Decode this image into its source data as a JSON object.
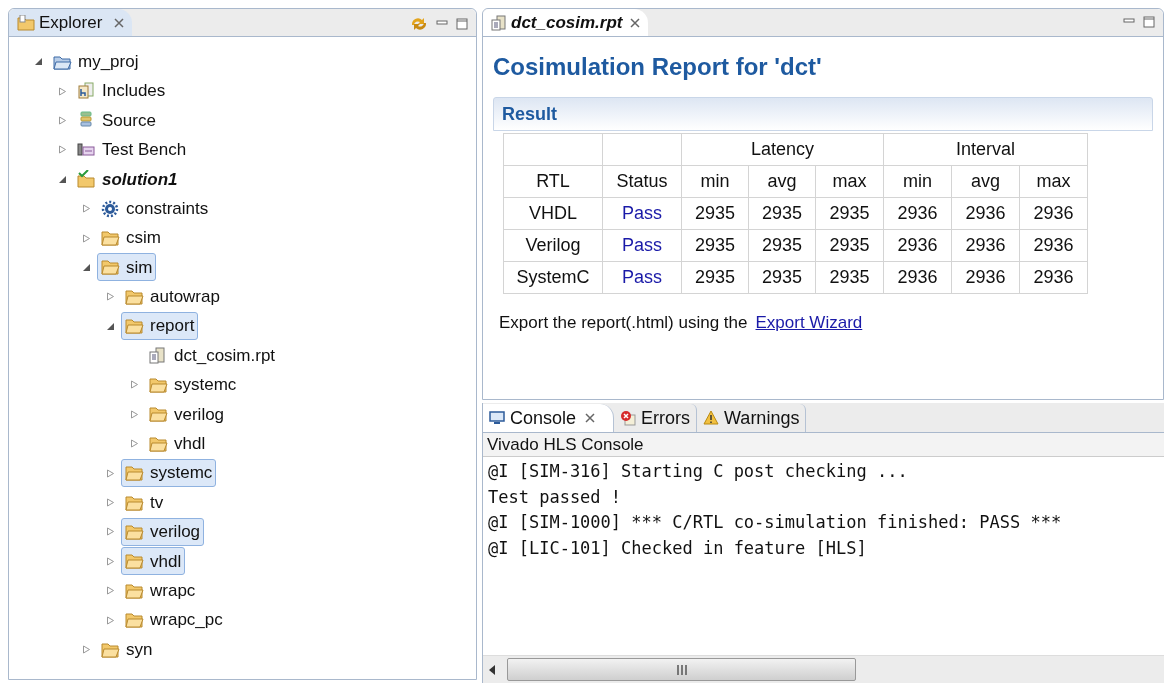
{
  "explorer": {
    "title": "Explorer",
    "tree": [
      {
        "label": "my_proj",
        "kind": "project",
        "expanded": true,
        "selected": false,
        "emphasized": false,
        "children": [
          {
            "label": "Includes",
            "kind": "includes",
            "expanded": false,
            "selected": false,
            "emphasized": false
          },
          {
            "label": "Source",
            "kind": "source",
            "expanded": false,
            "selected": false,
            "emphasized": false
          },
          {
            "label": "Test Bench",
            "kind": "testbench",
            "expanded": false,
            "selected": false,
            "emphasized": false
          },
          {
            "label": "solution1",
            "kind": "solution",
            "expanded": true,
            "selected": false,
            "emphasized": true,
            "children": [
              {
                "label": "constraints",
                "kind": "constraints",
                "expanded": false,
                "selected": false,
                "emphasized": false
              },
              {
                "label": "csim",
                "kind": "folder",
                "expanded": false,
                "selected": false,
                "emphasized": false
              },
              {
                "label": "sim",
                "kind": "folder",
                "expanded": true,
                "selected": true,
                "emphasized": false,
                "children": [
                  {
                    "label": "autowrap",
                    "kind": "folder",
                    "expanded": false,
                    "selected": false,
                    "emphasized": false
                  },
                  {
                    "label": "report",
                    "kind": "folder",
                    "expanded": true,
                    "selected": true,
                    "emphasized": false,
                    "children": [
                      {
                        "label": "dct_cosim.rpt",
                        "kind": "file",
                        "selected": false,
                        "emphasized": false
                      },
                      {
                        "label": "systemc",
                        "kind": "folder",
                        "expanded": false,
                        "selected": false,
                        "emphasized": false
                      },
                      {
                        "label": "verilog",
                        "kind": "folder",
                        "expanded": false,
                        "selected": false,
                        "emphasized": false
                      },
                      {
                        "label": "vhdl",
                        "kind": "folder",
                        "expanded": false,
                        "selected": false,
                        "emphasized": false
                      }
                    ]
                  },
                  {
                    "label": "systemc",
                    "kind": "folder",
                    "expanded": false,
                    "selected": true,
                    "emphasized": false
                  },
                  {
                    "label": "tv",
                    "kind": "folder",
                    "expanded": false,
                    "selected": false,
                    "emphasized": false
                  },
                  {
                    "label": "verilog",
                    "kind": "folder",
                    "expanded": false,
                    "selected": true,
                    "emphasized": false
                  },
                  {
                    "label": "vhdl",
                    "kind": "folder",
                    "expanded": false,
                    "selected": true,
                    "emphasized": false
                  },
                  {
                    "label": "wrapc",
                    "kind": "folder",
                    "expanded": false,
                    "selected": false,
                    "emphasized": false
                  },
                  {
                    "label": "wrapc_pc",
                    "kind": "folder",
                    "expanded": false,
                    "selected": false,
                    "emphasized": false
                  }
                ]
              },
              {
                "label": "syn",
                "kind": "folder",
                "expanded": false,
                "selected": false,
                "emphasized": false
              }
            ]
          }
        ]
      }
    ]
  },
  "editor": {
    "tab": "dct_cosim.rpt",
    "heading": "Cosimulation Report for 'dct'",
    "section": "Result",
    "table": {
      "groups": [
        "Latency",
        "Interval"
      ],
      "columns": [
        "RTL",
        "Status",
        "min",
        "avg",
        "max",
        "min",
        "avg",
        "max"
      ],
      "rows": [
        [
          "VHDL",
          "Pass",
          "2935",
          "2935",
          "2935",
          "2936",
          "2936",
          "2936"
        ],
        [
          "Verilog",
          "Pass",
          "2935",
          "2935",
          "2935",
          "2936",
          "2936",
          "2936"
        ],
        [
          "SystemC",
          "Pass",
          "2935",
          "2935",
          "2935",
          "2936",
          "2936",
          "2936"
        ]
      ]
    },
    "export_text": "Export the report(.html) using the",
    "export_link": "Export Wizard"
  },
  "console": {
    "tabs": [
      {
        "label": "Console",
        "kind": "console",
        "selected": true
      },
      {
        "label": "Errors",
        "kind": "errors",
        "selected": false
      },
      {
        "label": "Warnings",
        "kind": "warnings",
        "selected": false
      }
    ],
    "title": "Vivado HLS Console",
    "lines": [
      "@I [SIM-316] Starting C post checking ...",
      "Test passed !",
      "@I [SIM-1000] *** C/RTL co-simulation finished: PASS ***",
      "@I [LIC-101] Checked in feature [HLS]"
    ]
  }
}
